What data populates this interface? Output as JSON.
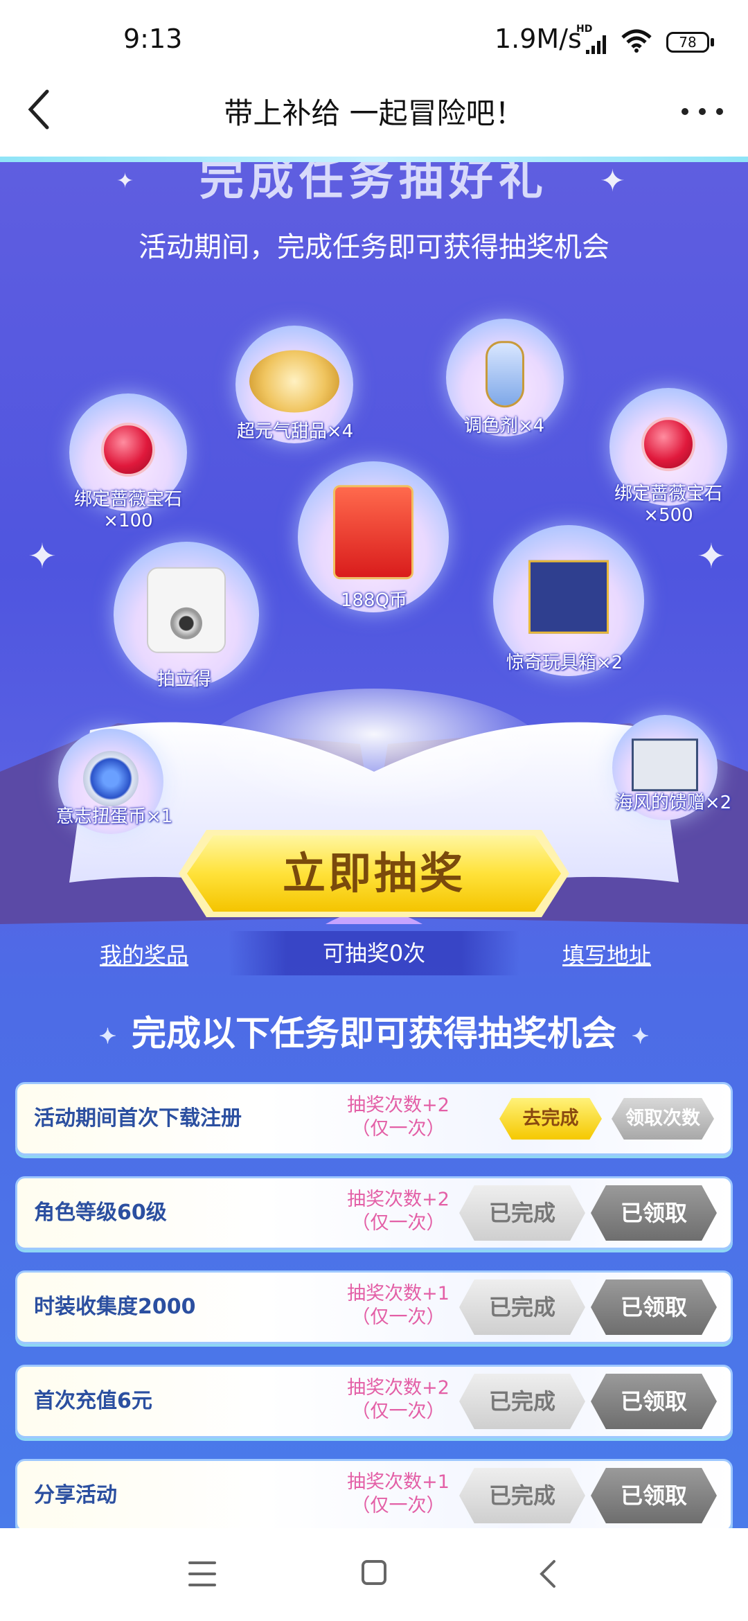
{
  "status_bar": {
    "time": "9:13",
    "rate": "1.9M/s",
    "hd": "HD",
    "battery": "78"
  },
  "title_bar": {
    "title": "带上补给 一起冒险吧！"
  },
  "banner": {
    "headline": "完成任务抽好礼",
    "subtitle": "活动期间，完成任务即可获得抽奖机会"
  },
  "prizes": [
    {
      "label": "超元气甜品×4",
      "icon": "dessert-plate-icon"
    },
    {
      "label": "调色剂×4",
      "icon": "potion-bottle-icon"
    },
    {
      "label": "绑定蔷薇宝石",
      "sub": "×100",
      "icon": "red-gem-icon"
    },
    {
      "label": "绑定蔷薇宝石",
      "sub": "×500",
      "icon": "red-gem-icon"
    },
    {
      "label": "188Q币",
      "icon": "red-envelope-icon"
    },
    {
      "label": "拍立得",
      "icon": "instant-camera-icon"
    },
    {
      "label": "惊奇玩具箱×2",
      "icon": "gift-box-icon"
    },
    {
      "label": "意志扭蛋币×1",
      "icon": "coin-icon"
    },
    {
      "label": "海风的馈赠×2",
      "icon": "small-gift-icon"
    }
  ],
  "draw": {
    "button_label": "立即抽奖",
    "my_prizes": "我的奖品",
    "chances": "可抽奖0次",
    "fill_address": "填写地址"
  },
  "tasks_section": {
    "title": "完成以下任务即可获得抽奖机会",
    "star": "✦"
  },
  "tasks": [
    {
      "name": "活动期间首次下载注册",
      "reward": "抽奖次数+2",
      "note": "（仅一次）",
      "action": "去完成",
      "claim": "领取次数"
    },
    {
      "name": "角色等级60级",
      "reward": "抽奖次数+2",
      "note": "（仅一次）",
      "action": "已完成",
      "claim": "已领取"
    },
    {
      "name": "时装收集度2000",
      "reward": "抽奖次数+1",
      "note": "（仅一次）",
      "action": "已完成",
      "claim": "已领取"
    },
    {
      "name": "首次充值6元",
      "reward": "抽奖次数+2",
      "note": "（仅一次）",
      "action": "已完成",
      "claim": "已领取"
    },
    {
      "name": "分享活动",
      "reward": "抽奖次数+1",
      "note": "（仅一次）",
      "action": "已完成",
      "claim": "已领取"
    }
  ],
  "colors": {
    "accent_blue": "#4f55df",
    "gold": "#f5c800",
    "pink_text": "#e35fa6",
    "task_text": "#2b4fa0"
  }
}
